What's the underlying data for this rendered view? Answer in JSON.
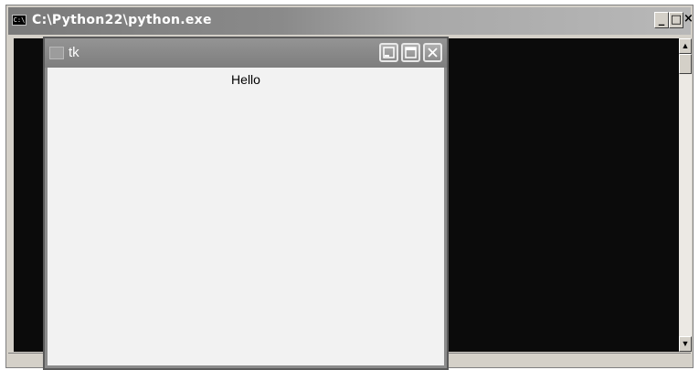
{
  "console_window": {
    "title": "C:\\Python22\\python.exe",
    "icon": "console-icon",
    "icon_text": "C:\\",
    "buttons": {
      "minimize": "_",
      "maximize": "□",
      "close": "×"
    },
    "scroll": {
      "up": "▲",
      "down": "▼"
    },
    "colors": {
      "background": "#0b0b0b",
      "titlebar": "#8a8a8a"
    }
  },
  "tk_window": {
    "title": "tk",
    "icon": "tk-feather-icon",
    "label": "Hello",
    "colors": {
      "content": "#f2f2f2",
      "titlebar": "#8c8c8c"
    }
  }
}
